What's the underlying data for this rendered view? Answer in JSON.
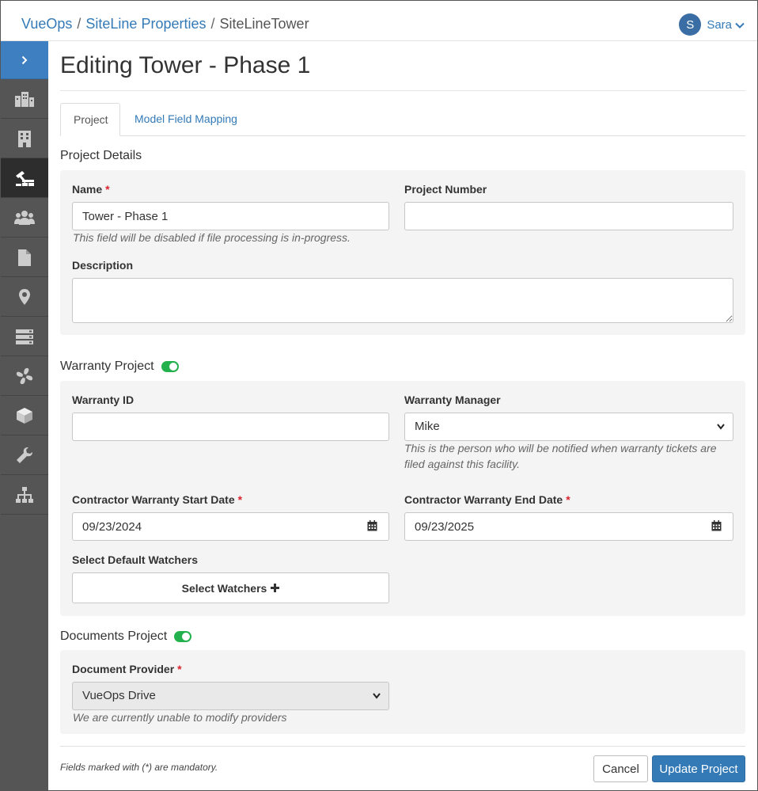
{
  "breadcrumb": {
    "items": [
      "VueOps",
      "SiteLine Properties"
    ],
    "separator": "/",
    "current": "SiteLineTower"
  },
  "user": {
    "initial": "S",
    "name": "Sara"
  },
  "sidebar": {
    "items": [
      "chevron-right",
      "buildings",
      "building",
      "construction",
      "users",
      "document",
      "location",
      "server",
      "fan",
      "cube",
      "wrench",
      "sitemap"
    ],
    "active_index": 3
  },
  "page": {
    "title": "Editing Tower - Phase 1"
  },
  "tabs": [
    {
      "label": "Project",
      "active": true
    },
    {
      "label": "Model Field Mapping",
      "active": false
    }
  ],
  "project_details": {
    "section_title": "Project Details",
    "name_label": "Name",
    "name_value": "Tower - Phase 1",
    "name_help": "This field will be disabled if file processing is in-progress.",
    "project_number_label": "Project Number",
    "project_number_value": "",
    "description_label": "Description",
    "description_value": ""
  },
  "warranty": {
    "section_title": "Warranty Project",
    "enabled": true,
    "warranty_id_label": "Warranty ID",
    "warranty_id_value": "",
    "manager_label": "Warranty Manager",
    "manager_value": "Mike",
    "manager_help": "This is the person who will be notified when warranty tickets are filed against this facility.",
    "start_label": "Contractor Warranty Start Date",
    "start_value": "09/23/2024",
    "end_label": "Contractor Warranty End Date",
    "end_value": "09/23/2025",
    "watchers_label": "Select Default Watchers",
    "watchers_button": "Select Watchers"
  },
  "documents": {
    "section_title": "Documents Project",
    "enabled": true,
    "provider_label": "Document Provider",
    "provider_value": "VueOps Drive",
    "provider_help": "We are currently unable to modify providers"
  },
  "footer": {
    "note": "Fields marked with (*) are mandatory.",
    "cancel_label": "Cancel",
    "submit_label": "Update Project"
  },
  "required_marker": "*",
  "colors": {
    "accent": "#337ab7",
    "sidebar": "#555555",
    "toggle_on": "#22b14c",
    "required": "#d9232d"
  }
}
